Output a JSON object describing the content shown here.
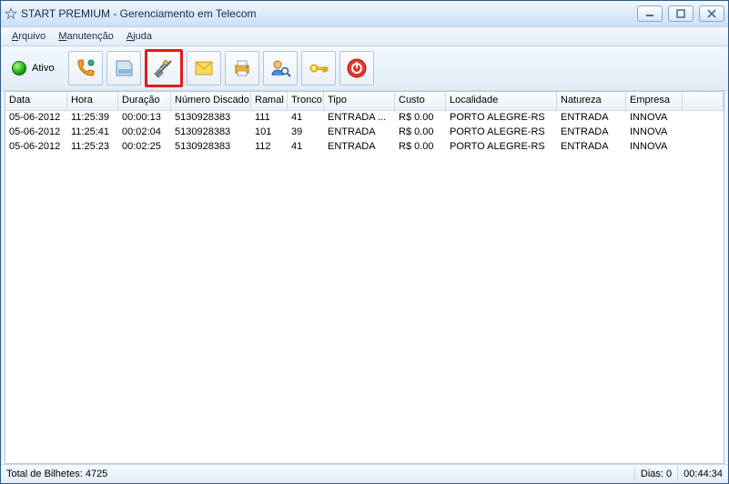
{
  "title": "START PREMIUM - Gerenciamento em Telecom",
  "menu": {
    "arquivo": "Arquivo",
    "manutencao": "Manutenção",
    "ajuda": "Ajuda"
  },
  "toolbar": {
    "status_label": "Ativo"
  },
  "icons": {
    "app": "star-icon",
    "min": "minimize-icon",
    "max": "maximize-icon",
    "close": "close-icon",
    "calls": "phone-icon",
    "db": "database-icon",
    "tools": "tools-icon",
    "mail": "mail-icon",
    "print": "printer-icon",
    "user": "user-search-icon",
    "key": "key-icon",
    "power": "power-icon"
  },
  "columns": [
    "Data",
    "Hora",
    "Duração",
    "Número Discado",
    "Ramal",
    "Tronco",
    "Tipo",
    "Custo",
    "Localidade",
    "Natureza",
    "Empresa"
  ],
  "rows": [
    {
      "data": "05-06-2012",
      "hora": "11:25:39",
      "dur": "00:00:13",
      "num": "5130928383",
      "ramal": "111",
      "tronco": "41",
      "tipo": "ENTRADA ...",
      "custo": "R$ 0.00",
      "loc": "PORTO ALEGRE-RS",
      "nat": "ENTRADA",
      "emp": "INNOVA"
    },
    {
      "data": "05-06-2012",
      "hora": "11:25:41",
      "dur": "00:02:04",
      "num": "5130928383",
      "ramal": "101",
      "tronco": "39",
      "tipo": "ENTRADA",
      "custo": "R$ 0.00",
      "loc": "PORTO ALEGRE-RS",
      "nat": "ENTRADA",
      "emp": "INNOVA"
    },
    {
      "data": "05-06-2012",
      "hora": "11:25:23",
      "dur": "00:02:25",
      "num": "5130928383",
      "ramal": "112",
      "tronco": "41",
      "tipo": "ENTRADA",
      "custo": "R$ 0.00",
      "loc": "PORTO ALEGRE-RS",
      "nat": "ENTRADA",
      "emp": "INNOVA"
    }
  ],
  "status": {
    "total": "Total de Bilhetes: 4725",
    "dias": "Dias: 0",
    "clock": "00:44:34"
  }
}
